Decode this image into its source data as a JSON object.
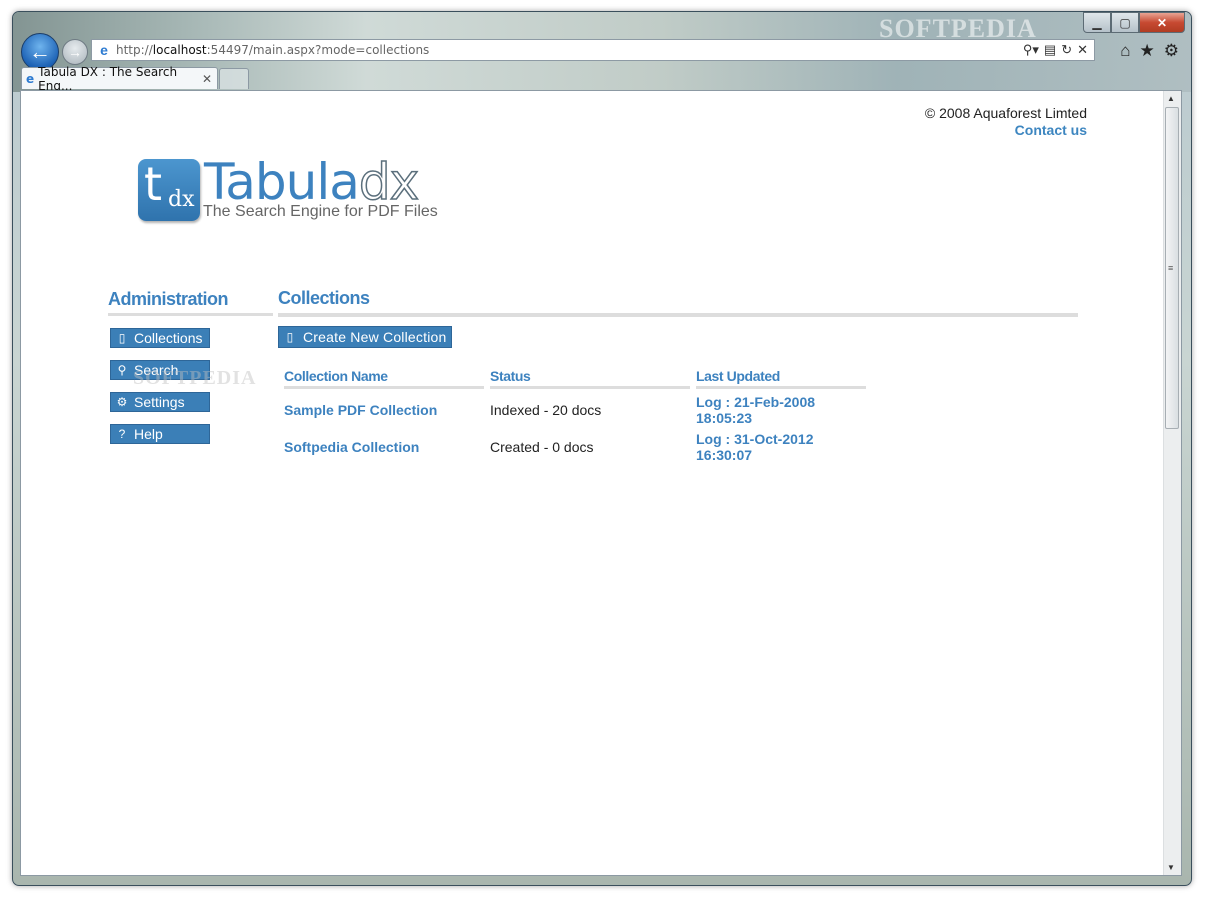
{
  "browser": {
    "title_watermark": "SOFTPEDIA",
    "url_prefix": "http://",
    "url_host": "localhost",
    "url_rest": ":54497/main.aspx?mode=collections",
    "tab_title": "Tabula DX : The Search Eng...",
    "minimize": "▁",
    "maximize": "▢",
    "close": "✕",
    "tab_close": "✕"
  },
  "header": {
    "copyright": "© 2008 Aquaforest Limted",
    "contact": "Contact us"
  },
  "logo": {
    "t": "t",
    "dx": "dx",
    "word_main": "Tabula",
    "word_outline": "dx",
    "tagline": "The Search Engine for PDF Files"
  },
  "sidebar": {
    "title": "Administration",
    "items": [
      {
        "label": "Collections",
        "icon": "document-icon"
      },
      {
        "label": "Search",
        "icon": "search-icon"
      },
      {
        "label": "Settings",
        "icon": "gear-icon"
      },
      {
        "label": "Help",
        "icon": "help-icon"
      }
    ],
    "watermark": "SOFTPEDIA"
  },
  "main": {
    "title": "Collections",
    "create_label": "Create New Collection",
    "columns": [
      "Collection Name",
      "Status",
      "Last Updated"
    ],
    "rows": [
      {
        "name": "Sample PDF Collection",
        "status": "Indexed - 20 docs",
        "updated": "Log : 21-Feb-2008 18:05:23"
      },
      {
        "name": "Softpedia Collection",
        "status": "Created - 0 docs",
        "updated": "Log : 31-Oct-2012 16:30:07"
      }
    ]
  }
}
